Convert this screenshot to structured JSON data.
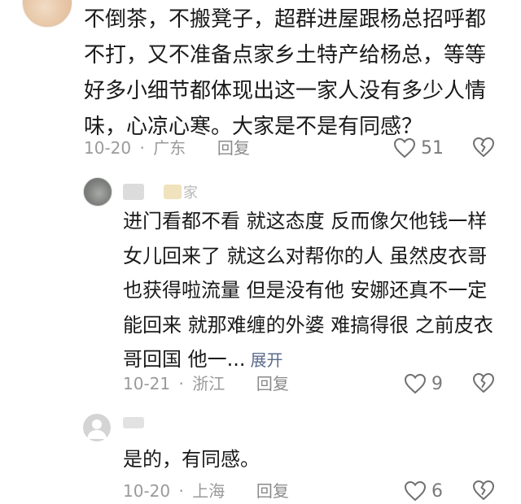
{
  "comments": [
    {
      "text": "不倒茶，不搬凳子，超群进屋跟杨总招呼都不打，又不准备点家乡土特产给杨总，等等好多小细节都体现出这一家人没有多少人情味，心凉心寒。大家是不是有同感？",
      "date": "10-20",
      "separator": "·",
      "location": "广东",
      "reply_label": "回复",
      "likes": "51"
    },
    {
      "username_partial": "家",
      "text": "进门看都不看 就这态度 反而像欠他钱一样 女儿回来了 就这么对帮你的人 虽然皮衣哥也获得啦流量 但是没有他 安娜还真不一定能回来 就那难缠的外婆 难搞得很 之前皮衣哥回国 他一...",
      "expand_label": "展开",
      "date": "10-21",
      "separator": "·",
      "location": "浙江",
      "reply_label": "回复",
      "likes": "9"
    },
    {
      "text": "是的，有同感。",
      "date": "10-20",
      "separator": "·",
      "location": "上海",
      "reply_label": "回复",
      "likes": "6"
    }
  ],
  "colors": {
    "text": "#1a1a1a",
    "meta": "#9a9a9a",
    "link": "#5b6b8c",
    "icon": "#707070"
  }
}
